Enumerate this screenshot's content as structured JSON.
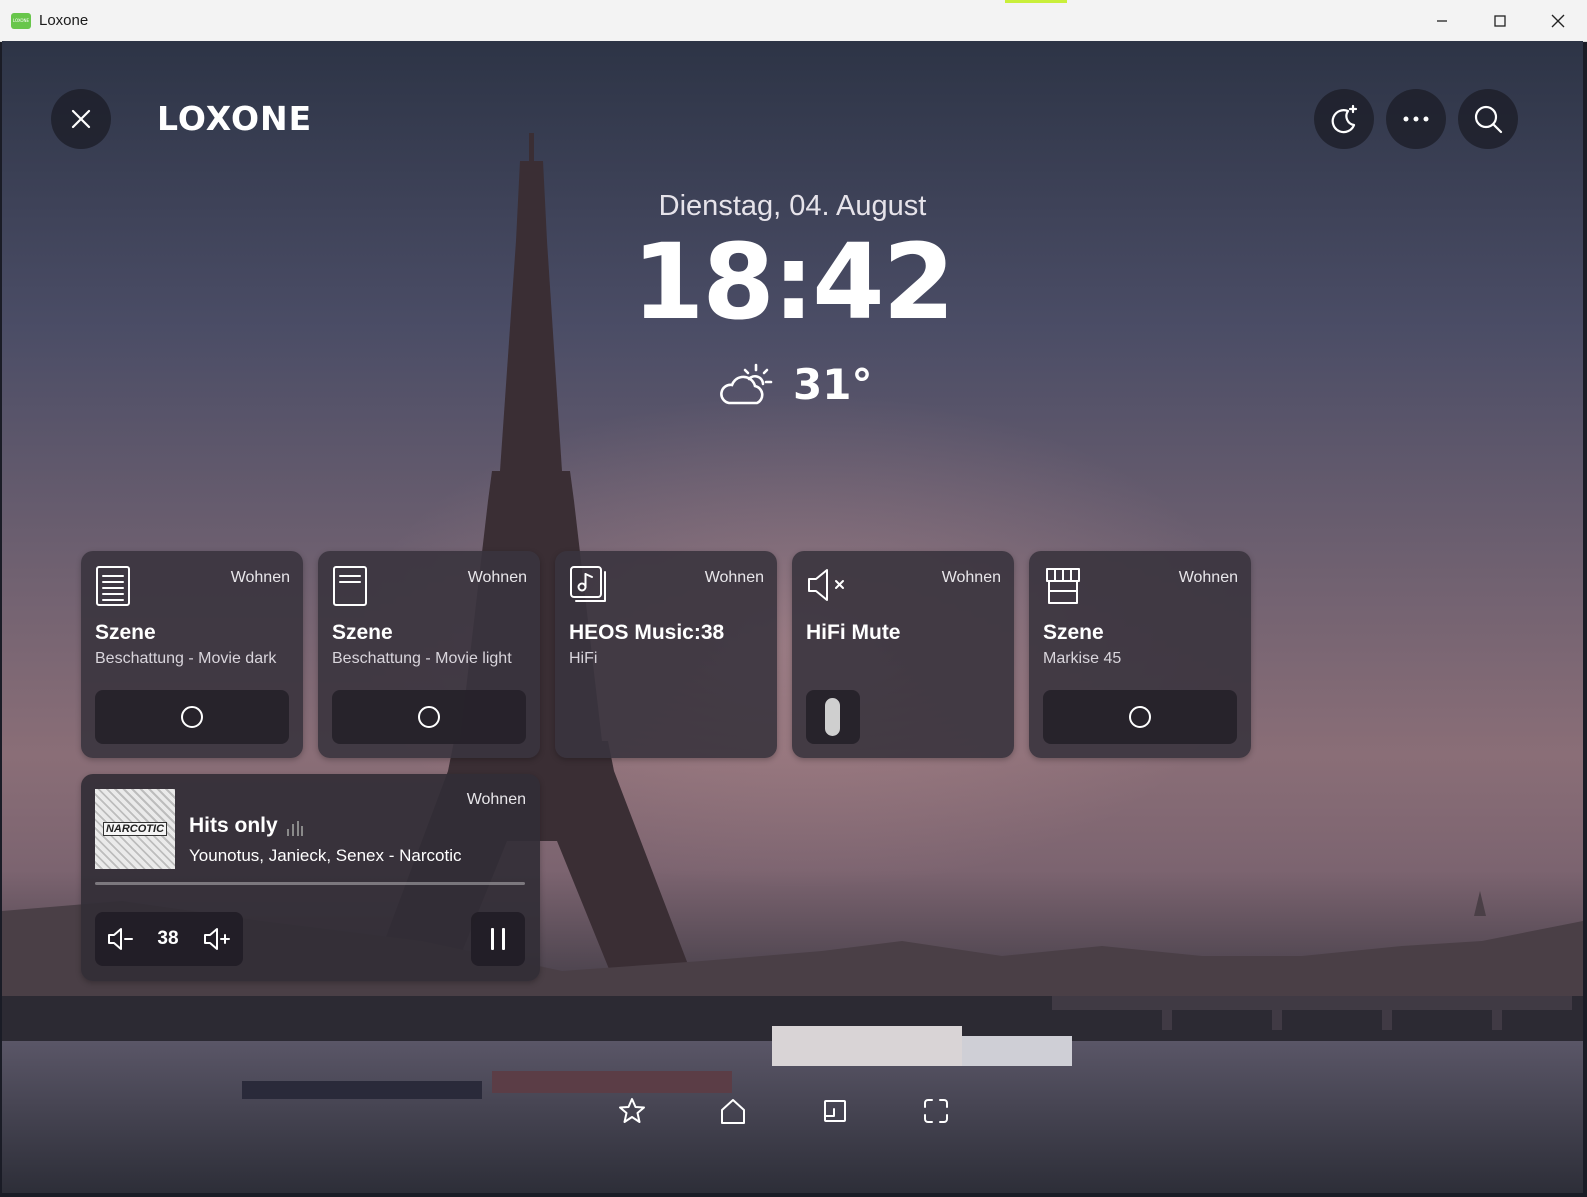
{
  "window": {
    "title": "Loxone",
    "icon_text": "LOXONE",
    "controls": [
      "minimize-icon",
      "maximize-icon",
      "close-icon"
    ]
  },
  "header": {
    "logo": "LOXONE",
    "buttons": [
      "close-icon",
      "night-mode-icon",
      "more-icon",
      "search-icon"
    ]
  },
  "status": {
    "date": "Dienstag, 04. August",
    "time": "18:42",
    "temperature": "31°",
    "weather_icon": "partly-cloudy-icon"
  },
  "cards": [
    {
      "icon": "scene-list-icon",
      "room": "Wohnen",
      "title": "Szene",
      "subtitle": "Beschattung - Movie dark",
      "control": "circle-button"
    },
    {
      "icon": "scene-list-icon",
      "room": "Wohnen",
      "title": "Szene",
      "subtitle": "Beschattung - Movie light",
      "control": "circle-button"
    },
    {
      "icon": "music-icon",
      "room": "Wohnen",
      "title": "HEOS Music:38",
      "subtitle": "HiFi",
      "control": "none"
    },
    {
      "icon": "speaker-mute-icon",
      "room": "Wohnen",
      "title": "HiFi Mute",
      "subtitle": "",
      "control": "switch",
      "switch_on": false
    },
    {
      "icon": "awning-icon",
      "room": "Wohnen",
      "title": "Szene",
      "subtitle": "Markise 45",
      "control": "circle-button"
    }
  ],
  "music": {
    "room": "Wohnen",
    "album_art_text": "NARCOTIC",
    "title": "Hits only",
    "artist": "Younotus, Janieck, Senex - Narcotic",
    "volume": "38",
    "progress": 0.0
  },
  "bottom_nav": [
    "favorites-star-icon",
    "home-icon",
    "rooms-icon",
    "categories-icon"
  ],
  "colors": {
    "card_bg": "#3a343e",
    "accent_green": "#68c64b",
    "text": "#ffffff"
  }
}
